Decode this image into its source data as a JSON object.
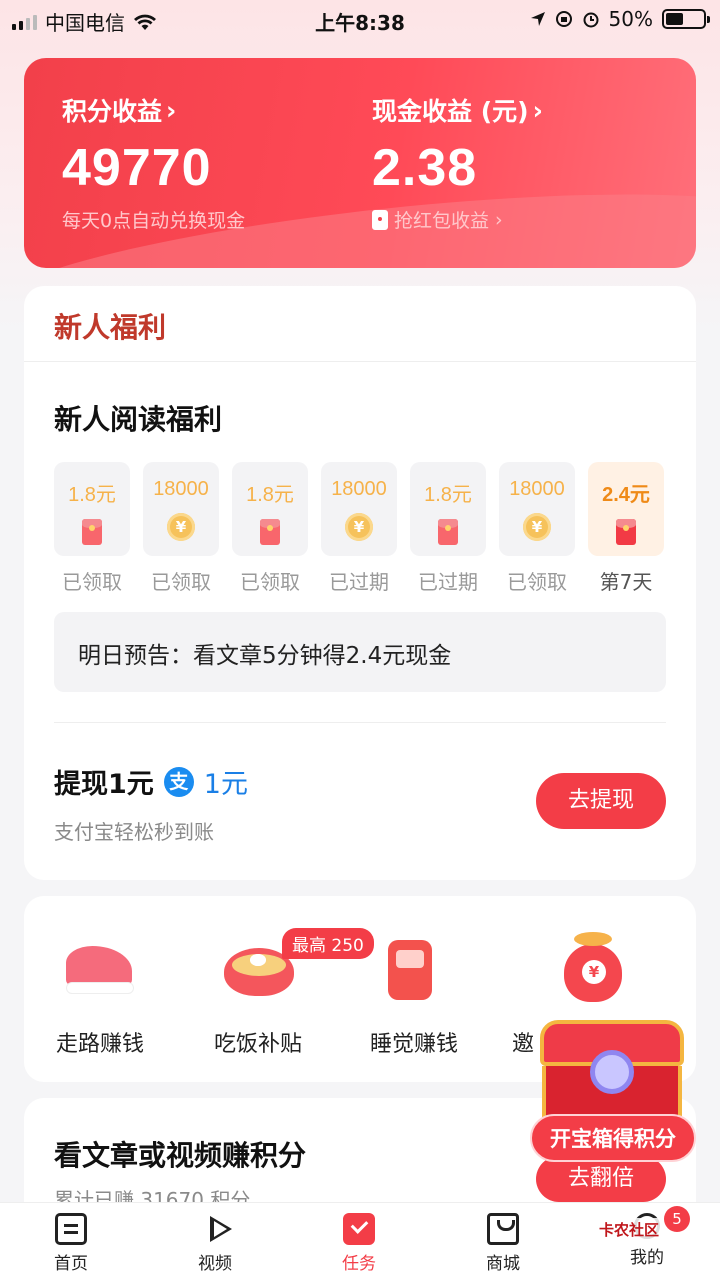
{
  "status_bar": {
    "carrier": "中国电信",
    "time": "上午8:38",
    "battery": "50%"
  },
  "earnings": {
    "points_title": "积分收益",
    "points_value": "49770",
    "points_note": "每天0点自动兑换现金",
    "cash_title": "现金收益 (元)",
    "cash_value": "2.38",
    "cash_note": "抢红包收益"
  },
  "newcomer": {
    "header": "新人福利",
    "reading_title": "新人阅读福利",
    "days": [
      {
        "amount": "1.8元",
        "icon": "red-packet-icon",
        "status": "已领取"
      },
      {
        "amount": "18000",
        "icon": "coin-icon",
        "status": "已领取"
      },
      {
        "amount": "1.8元",
        "icon": "red-packet-icon",
        "status": "已领取"
      },
      {
        "amount": "18000",
        "icon": "coin-icon",
        "status": "已过期"
      },
      {
        "amount": "1.8元",
        "icon": "red-packet-icon",
        "status": "已过期"
      },
      {
        "amount": "18000",
        "icon": "coin-icon",
        "status": "已领取"
      },
      {
        "amount": "2.4元",
        "icon": "red-packet-icon",
        "status": "第7天"
      }
    ],
    "preview": "明日预告：看文章5分钟得2.4元现金",
    "withdraw_title": "提现1元",
    "alipay_glyph": "支",
    "withdraw_amount": "1元",
    "withdraw_note": "支付宝轻松秒到账",
    "withdraw_button": "去提现"
  },
  "features": {
    "items": [
      {
        "label": "走路赚钱",
        "icon": "sneaker-icon"
      },
      {
        "label": "吃饭补贴",
        "icon": "noodle-bowl-icon"
      },
      {
        "label": "睡觉赚钱",
        "icon": "alarm-clock-icon"
      },
      {
        "label": "邀",
        "icon": "money-bag-icon"
      }
    ],
    "meal_tag": "最高 250"
  },
  "earn_points": {
    "title": "看文章或视频赚积分",
    "subtitle": "累计已赚 31670 积分",
    "double_button": "去翻倍"
  },
  "treasure": {
    "button": "开宝箱得积分"
  },
  "tabbar": {
    "items": [
      {
        "label": "首页",
        "icon": "home-icon"
      },
      {
        "label": "视频",
        "icon": "play-icon"
      },
      {
        "label": "任务",
        "icon": "task-check-icon"
      },
      {
        "label": "商城",
        "icon": "shop-bag-icon"
      },
      {
        "label": "我的",
        "icon": "profile-icon"
      }
    ],
    "active": "任务",
    "badge": "5"
  },
  "watermark": "卡农社区",
  "colors": {
    "accent": "#f33d47",
    "header_red": "#c0392b",
    "gold": "#f6b24a",
    "alipay_blue": "#1a8cf0"
  }
}
